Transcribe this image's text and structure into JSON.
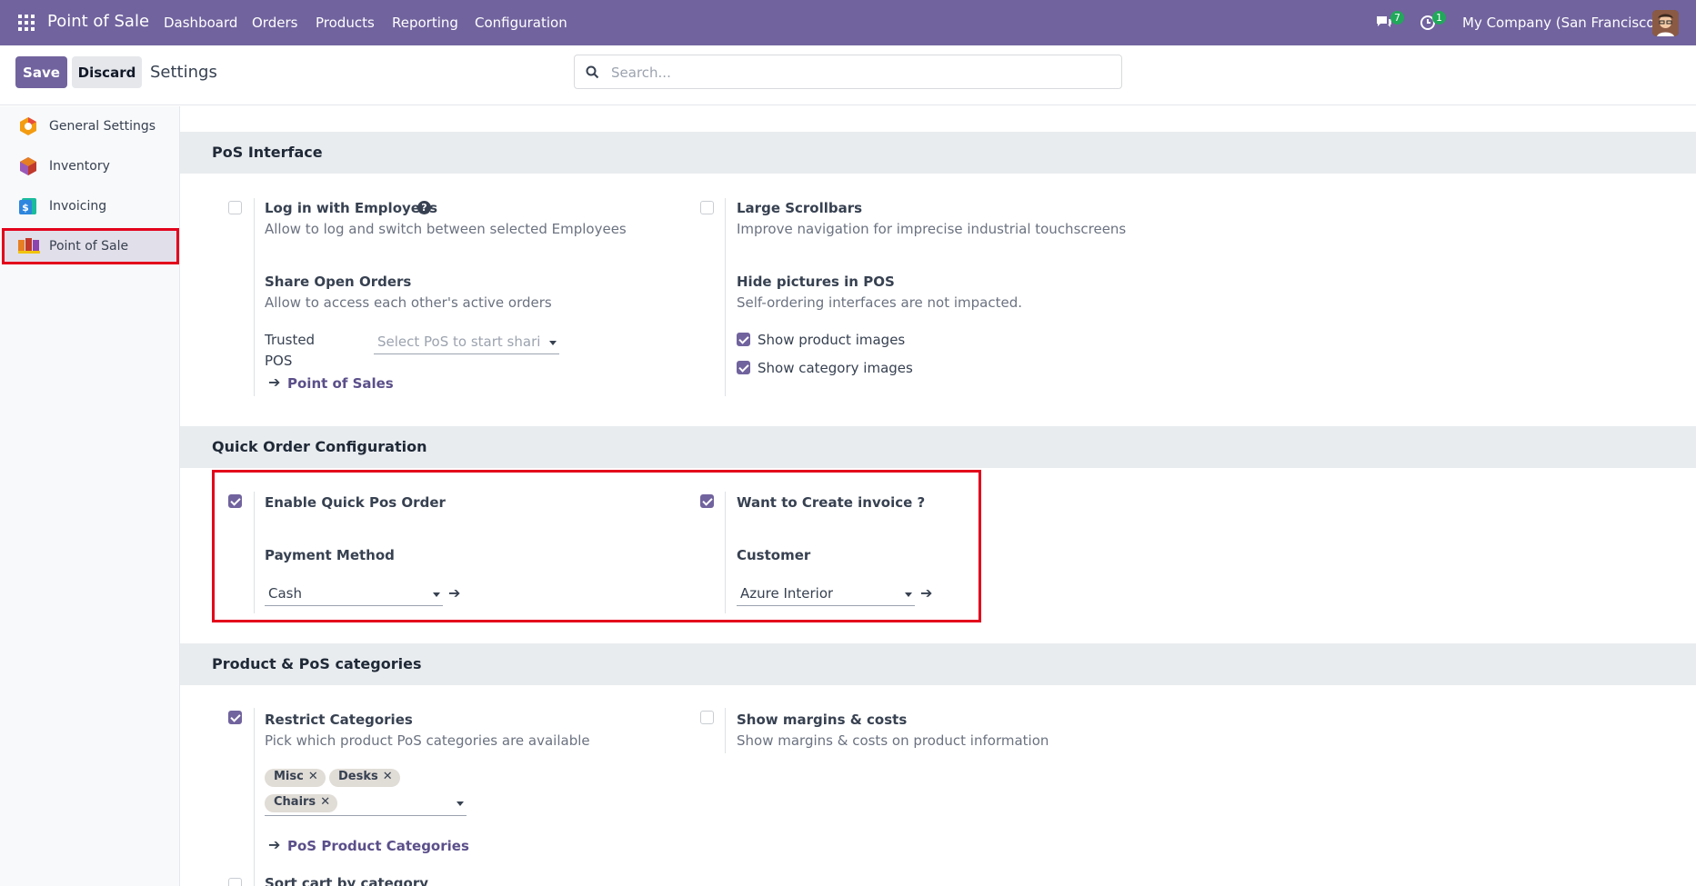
{
  "navbar": {
    "brand": "Point of Sale",
    "menu": [
      "Dashboard",
      "Orders",
      "Products",
      "Reporting",
      "Configuration"
    ],
    "messages_count": "7",
    "activities_count": "1",
    "company": "My Company (San Francisco)"
  },
  "controlbar": {
    "save_label": "Save",
    "discard_label": "Discard",
    "title": "Settings",
    "search_placeholder": "Search..."
  },
  "sidebar": {
    "items": [
      {
        "label": "General Settings",
        "icon": "odoo-settings-icon"
      },
      {
        "label": "Inventory",
        "icon": "inventory-icon"
      },
      {
        "label": "Invoicing",
        "icon": "invoicing-icon"
      },
      {
        "label": "Point of Sale",
        "icon": "point-of-sale-icon",
        "active": true
      }
    ]
  },
  "sections": {
    "pos_interface": {
      "title": "PoS Interface",
      "login_employees": {
        "title": "Log in with Employees",
        "desc": "Allow to log and switch between selected Employees",
        "checked": false
      },
      "large_scrollbars": {
        "title": "Large Scrollbars",
        "desc": "Improve navigation for imprecise industrial touchscreens",
        "checked": false
      },
      "share_orders": {
        "title": "Share Open Orders",
        "desc": "Allow to access each other's active orders"
      },
      "trusted_pos": {
        "label_line1": "Trusted",
        "label_line2": "POS",
        "placeholder": "Select PoS to start shari…"
      },
      "point_of_sales_link": "Point of Sales",
      "hide_pictures": {
        "title": "Hide pictures in POS",
        "desc": "Self-ordering interfaces are not impacted."
      },
      "show_product_images": {
        "label": "Show product images",
        "checked": true
      },
      "show_category_images": {
        "label": "Show category images",
        "checked": true
      }
    },
    "quick_order": {
      "title": "Quick Order Configuration",
      "enable": {
        "title": "Enable Quick Pos Order",
        "checked": true
      },
      "invoice": {
        "title": "Want to Create invoice ?",
        "checked": true
      },
      "payment_method": {
        "label": "Payment Method",
        "value": "Cash"
      },
      "customer": {
        "label": "Customer",
        "value": "Azure Interior"
      }
    },
    "product_categories": {
      "title": "Product & PoS categories",
      "restrict": {
        "title": "Restrict Categories",
        "desc": "Pick which product PoS categories are available",
        "checked": true
      },
      "margins": {
        "title": "Show margins & costs",
        "desc": "Show margins & costs on product information",
        "checked": false
      },
      "tags": [
        "Misc",
        "Desks",
        "Chairs"
      ],
      "categories_link": "PoS Product Categories",
      "sort_cart": {
        "title": "Sort cart by category",
        "checked": false
      }
    }
  },
  "colors": {
    "brand": "#71639e",
    "highlight": "#e3001b",
    "badge": "#21a85a"
  }
}
